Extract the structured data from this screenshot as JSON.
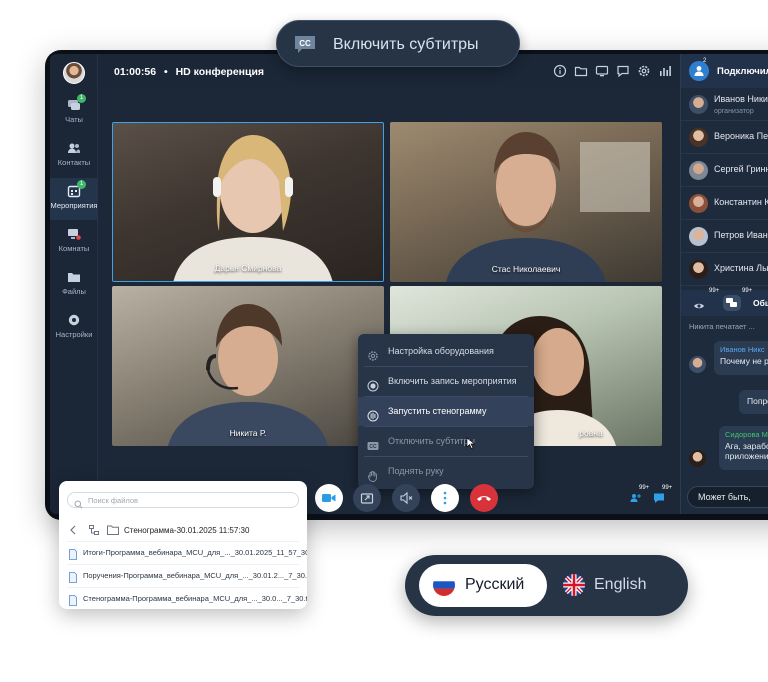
{
  "subtitles_pill": {
    "label": "Включить субтитры",
    "icon": "closed-captions-icon"
  },
  "call": {
    "time": "01:00:56",
    "separator": "•",
    "title": "HD конференция"
  },
  "sidebar": {
    "items": [
      {
        "label": "Чаты",
        "icon": "chat-icon",
        "badge": "1"
      },
      {
        "label": "Контакты",
        "icon": "contacts-icon"
      },
      {
        "label": "Мероприятия",
        "icon": "events-icon",
        "badge": "1"
      },
      {
        "label": "Комнаты",
        "icon": "rooms-icon"
      },
      {
        "label": "Файлы",
        "icon": "files-icon"
      },
      {
        "label": "Настройки",
        "icon": "settings-icon"
      }
    ]
  },
  "toolbar_icons": [
    "info-icon",
    "folder-icon",
    "screen-icon",
    "chat-icon",
    "gear-icon",
    "stats-icon"
  ],
  "participants_video": [
    {
      "name": "Дарья Смирнова"
    },
    {
      "name": "Стас Николаевич"
    },
    {
      "name": "Никита Р."
    },
    {
      "name": "ровна"
    }
  ],
  "context_menu": {
    "items": [
      {
        "label": "Настройка оборудования",
        "icon": "gear-icon"
      },
      {
        "label": "Включить запись мероприятия",
        "icon": "record-icon"
      },
      {
        "label": "Запустить стенограмму",
        "icon": "transcript-icon"
      },
      {
        "label": "Отключить субтитры",
        "icon": "closed-captions-icon"
      },
      {
        "label": "Поднять руку",
        "icon": "hand-icon"
      }
    ]
  },
  "controls": {
    "badge_left": "99+",
    "badge_right": "99+"
  },
  "right_panel": {
    "header_label": "Подключил",
    "header_count": "2",
    "people": [
      {
        "name": "Иванов Никита",
        "role": "организатор"
      },
      {
        "name": "Вероника Пет"
      },
      {
        "name": "Сергей Гринн"
      },
      {
        "name": "Константин К"
      },
      {
        "name": "Петров Иван"
      },
      {
        "name": "Христина Лых"
      }
    ],
    "tabs": {
      "badge1": "99+",
      "badge2": "99+",
      "label": "Общ"
    },
    "typing": "Никита печатает ...",
    "messages": [
      {
        "author": "Иванов Никс",
        "text": "Почему не р"
      },
      {
        "text": "Попро"
      },
      {
        "author": "Сидорова Ма",
        "text": "Ага, зарабо",
        "text2": "приложени"
      }
    ],
    "input_value": "Может быть,"
  },
  "files": {
    "search_placeholder": "Поиск файлов",
    "folder": "Стенограмма-30.01.2025 11:57:30",
    "items": [
      "Итоги-Программа_вебинара_MCU_для_..._30.01.2025_11_57_30.txt",
      "Поручения-Программа_вебинара_MCU_для_..._30.01.2..._7_30.txt",
      "Стенограмма-Программа_вебинара_MCU_для_..._30.0..._7_30.txt"
    ]
  },
  "languages": {
    "primary": "Русский",
    "secondary": "English"
  },
  "colors": {
    "accent": "#2f7fd1",
    "panel": "#1c2838",
    "hangup": "#d8323b",
    "camera": "#2b9de8"
  }
}
